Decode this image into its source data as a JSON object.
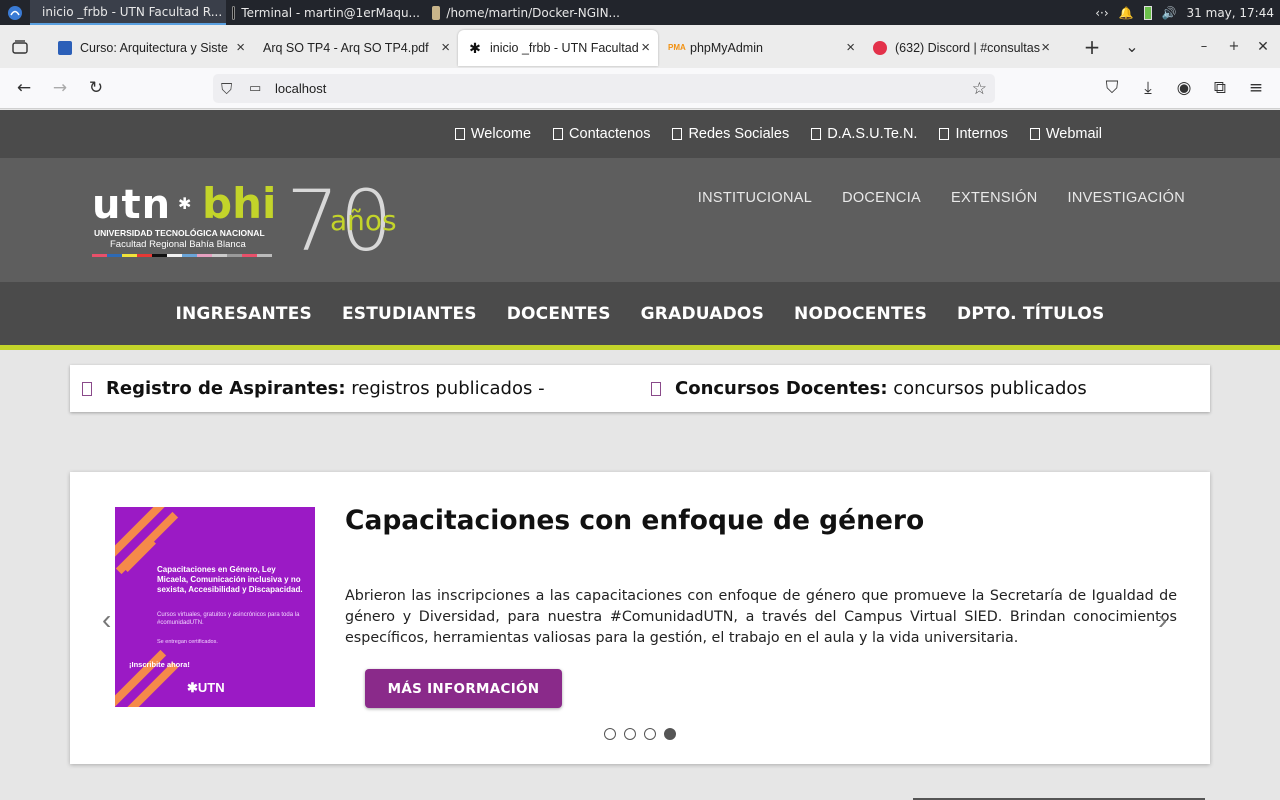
{
  "taskbar": {
    "items": [
      {
        "label": "inicio _frbb - UTN Facultad R...",
        "icon": "firefox-icon",
        "active": true
      },
      {
        "label": "Terminal - martin@1erMaqu...",
        "icon": "terminal-icon",
        "active": false
      },
      {
        "label": "/home/martin/Docker-NGIN...",
        "icon": "folder-icon",
        "active": false
      }
    ],
    "clock": "31 may, 17:44"
  },
  "tabs": [
    {
      "title": "Curso: Arquitectura y Siste",
      "icon": "moodle-icon",
      "color": "#2b5fb8"
    },
    {
      "title": "Arq SO TP4 - Arq SO TP4.pdf",
      "icon": "",
      "color": ""
    },
    {
      "title": "inicio _frbb - UTN Facultad",
      "icon": "utn-icon",
      "color": "#111111"
    },
    {
      "title": "phpMyAdmin",
      "icon": "phpmyadmin-icon",
      "color": "#f29111"
    },
    {
      "title": "(632) Discord | #consultas",
      "icon": "discord-icon",
      "color": "#e3314a"
    }
  ],
  "navbar": {
    "url": "localhost"
  },
  "page": {
    "top_links": [
      "Welcome",
      "Contactenos",
      "Redes Sociales",
      "D.A.S.U.Te.N.",
      "Internos",
      "Webmail"
    ],
    "logo": {
      "utn": "utn",
      "bhi": "bhi",
      "line1": "UNIVERSIDAD TECNOLÓGICA NACIONAL",
      "line2": "Facultad Regional Bahía Blanca",
      "seventy": "70",
      "anos": "años"
    },
    "main_menu": [
      "INSTITUCIONAL",
      "DOCENCIA",
      "EXTENSIÓN",
      "INVESTIGACIÓN"
    ],
    "secondary_menu": [
      "INGRESANTES",
      "ESTUDIANTES",
      "DOCENTES",
      "GRADUADOS",
      "NODOCENTES",
      "DPTO. TÍTULOS"
    ],
    "ticker": [
      {
        "title": "Registro de Aspirantes:",
        "text": " registros publicados -"
      },
      {
        "title": "Concursos Docentes:",
        "text": " concursos publicados"
      }
    ],
    "slide": {
      "heading": "Capacitaciones con enfoque de género",
      "body": "Abrieron las inscripciones a las capacitaciones con enfoque de género que promueve la Secretaría de Igualdad de género y Diversidad, para nuestra #ComunidadUTN, a través del Campus Virtual SIED. Brindan conocimientos específicos, herramientas valiosas para la gestión, el trabajo en el aula y la vida universitaria.",
      "button": "MÁS INFORMACIÓN",
      "promo": {
        "title": "Capacitaciones en Género, Ley Micaela, Comunicación inclusiva y no sexista, Accesibilidad y Discapacidad.",
        "subtitle": "Cursos virtuales, gratuitos y asincrónicos para toda la #comunidadUTN.",
        "cert": "Se entregan certificados.",
        "cta": "¡Inscribite ahora!",
        "brand": "UTN"
      },
      "active_dot": 3
    },
    "colors": {
      "accent": "#c3d42a",
      "button": "#8a2a8a",
      "promo_bg": "#9b1ac5"
    }
  }
}
